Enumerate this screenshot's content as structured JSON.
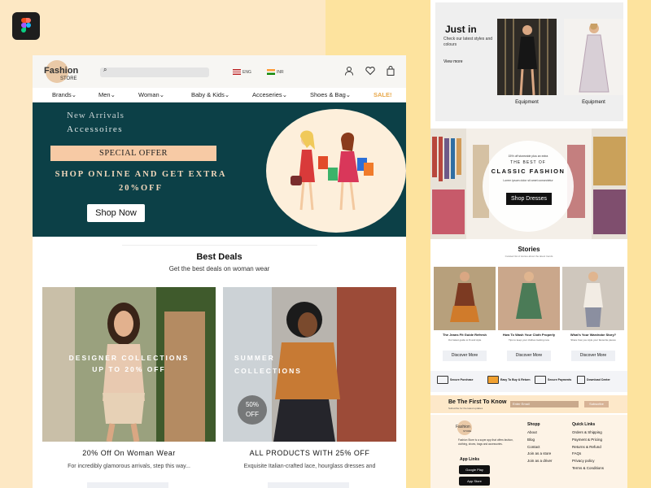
{
  "header": {
    "logo_line1": "Fashion",
    "logo_line2": "STORE",
    "search_icon": "search-icon",
    "lang1": "ENG",
    "lang2": "INR",
    "icons": [
      "user-icon",
      "heart-icon",
      "bag-icon"
    ]
  },
  "nav": {
    "items": [
      "Brands",
      "Men",
      "Woman",
      "Baby & Kids",
      "Acceseries",
      "Shoes & Bag"
    ],
    "sale": "SALE!"
  },
  "hero": {
    "new_arrivals": "New Arrivals",
    "accessories": "Accessoires",
    "special_offer": "SPECIAL OFFER",
    "shop_line1": "SHOP ONLINE AND GET EXTRA",
    "shop_line2": "20%OFF",
    "cta": "Shop Now"
  },
  "best_deals": {
    "title": "Best Deals",
    "subtitle": "Get the best deals on woman wear",
    "cards": [
      {
        "overlay1": "DESIGNER COLLECTIONS",
        "overlay2": "UP TO 20% OFF",
        "caption": "20% Off On Woman Wear",
        "desc": "For incredibly glamorous arrivals, step this way..."
      },
      {
        "overlay1": "SUMMER",
        "overlay2": "COLLECTIONS",
        "badge1": "50%",
        "badge2": "OFF",
        "caption": "ALL PRODUCTS WITH 25% OFF",
        "desc": "Exquisite Italian-crafted lace, hourglass dresses and"
      }
    ]
  },
  "just_in": {
    "title": "Just in",
    "desc": "Check our latest styles and colours",
    "view_more": "View more",
    "products": [
      "Equipment",
      "Equipment"
    ]
  },
  "classic": {
    "small": "15% off storewide plus an extra",
    "best_of": "THE BEST OF",
    "title": "CLASSIC FASHION",
    "desc": "Lorem ipsum dolor sit amet consectetur",
    "cta": "Shop Dresses"
  },
  "stories": {
    "title": "Stories",
    "subtitle": "Curated list of stories about the latest trends",
    "items": [
      {
        "title": "The Jeans Fit Guide Refresh",
        "desc": "Our latest guide to fit and style",
        "cta": "Discover More"
      },
      {
        "title": "How To Wash Your Cloth Properly",
        "desc": "Tips to keep your clothes looking new",
        "cta": "Discover More"
      },
      {
        "title": "What's Your Wardrobe Story?",
        "desc": "Share how you style your favourite pieces",
        "cta": "Discover More"
      }
    ]
  },
  "features": [
    "Secure Purchase",
    "Easy To Buy & Return",
    "Secure Payments",
    "Download Center"
  ],
  "newsletter": {
    "title": "Be The First To Know",
    "subtitle": "Subscribe for the latest updates",
    "placeholder": "Enter Email",
    "button": "Subscribe"
  },
  "footer": {
    "desc": "Fashion Store is a super app that offers fashion, clothing, shoes, bags and accessories.",
    "app_links": "App Links",
    "stores": [
      "Google Play",
      "App Store"
    ],
    "shop_title": "Shopp",
    "shop_links": [
      "About",
      "Blog",
      "Contact",
      "Join as a store",
      "Join as a driver"
    ],
    "quick_title": "Quick Links",
    "quick_links": [
      "Orders & Shipping",
      "Payment & Pricing",
      "Returns & Refund",
      "FAQs",
      "Privacy policy",
      "Terms & Conditions"
    ]
  },
  "colors": {
    "hero_bg": "#0c4047",
    "accent": "#f7caa5",
    "sale": "#e8a84a",
    "bg_left": "#fde8c4",
    "bg_right": "#fde39e"
  }
}
